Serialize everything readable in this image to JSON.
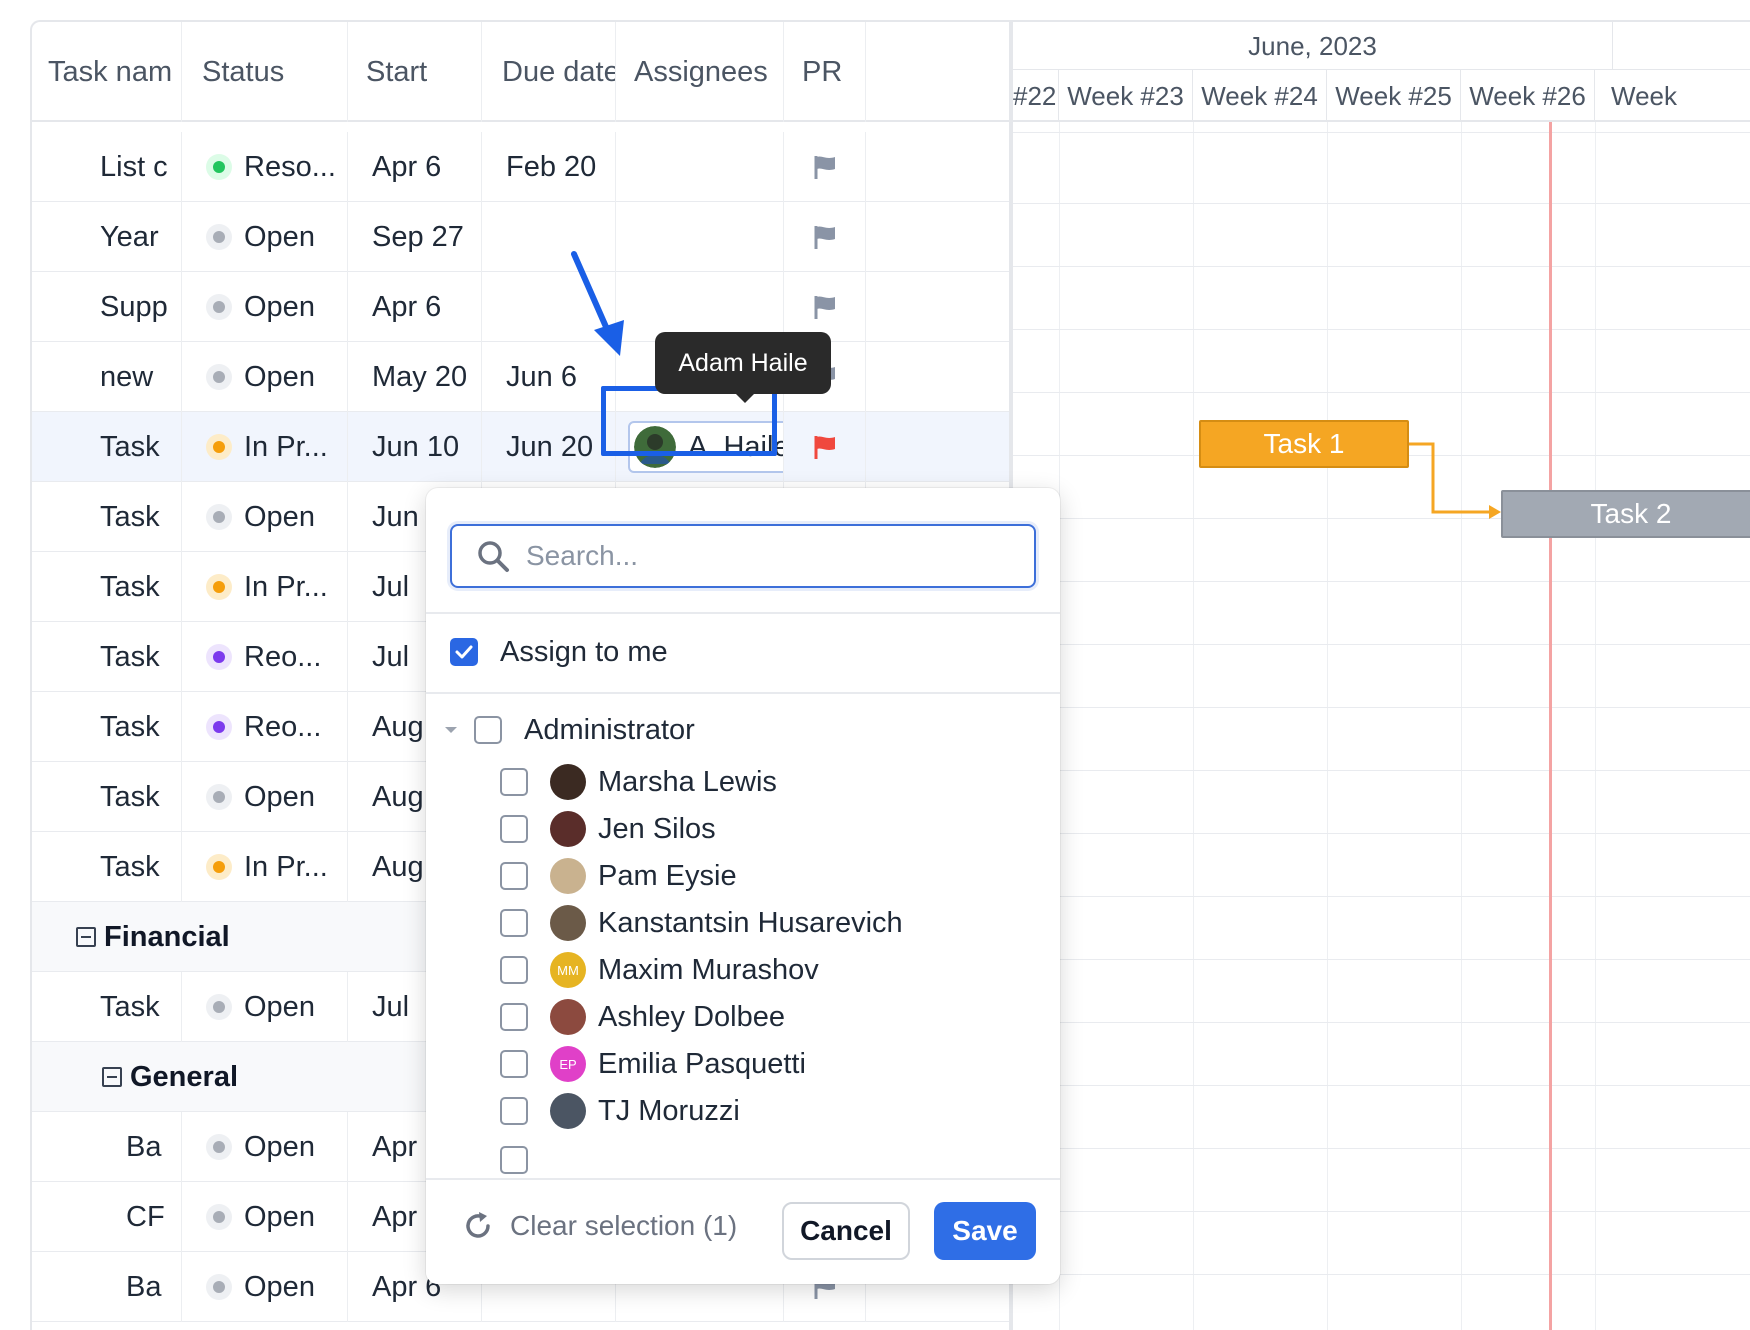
{
  "grid": {
    "headers": [
      "Task nam",
      "Status",
      "Start",
      "Due date",
      "Assignees",
      "PR"
    ],
    "rows": [
      {
        "name": "List c",
        "status": "Reso...",
        "status_color": "#22c55e",
        "start": "Apr 6",
        "due": "Feb 20",
        "flag": "gray"
      },
      {
        "name": "Year",
        "status": "Open",
        "status_color": "#a8adb6",
        "start": "Sep 27",
        "due": "",
        "flag": "gray"
      },
      {
        "name": "Supp",
        "status": "Open",
        "status_color": "#a8adb6",
        "start": "Apr 6",
        "due": "",
        "flag": "gray"
      },
      {
        "name": "new",
        "status": "Open",
        "status_color": "#a8adb6",
        "start": "May 20",
        "due": "Jun 6",
        "flag": "gray"
      },
      {
        "name": "Task",
        "status": "In Pr...",
        "status_color": "#f59e0b",
        "start": "Jun 10",
        "due": "Jun 20",
        "assignee": "A. Haile",
        "flag": "red"
      },
      {
        "name": "Task",
        "status": "Open",
        "status_color": "#a8adb6",
        "start": "Jun",
        "due": ""
      },
      {
        "name": "Task",
        "status": "In Pr...",
        "status_color": "#f59e0b",
        "start": "Jul",
        "due": ""
      },
      {
        "name": "Task",
        "status": "Reo...",
        "status_color": "#7c3aed",
        "start": "Jul",
        "due": ""
      },
      {
        "name": "Task",
        "status": "Reo...",
        "status_color": "#7c3aed",
        "start": "Aug",
        "due": ""
      },
      {
        "name": "Task",
        "status": "Open",
        "status_color": "#a8adb6",
        "start": "Aug",
        "due": ""
      },
      {
        "name": "Task",
        "status": "In Pr...",
        "status_color": "#f59e0b",
        "start": "Aug",
        "due": ""
      }
    ],
    "group_financial": "Financial",
    "financial_row": {
      "name": "Task",
      "status": "Open",
      "start": "Jul"
    },
    "group_general": "General",
    "general_rows": [
      {
        "name": "Ba",
        "status": "Open",
        "start": "Apr"
      },
      {
        "name": "CF",
        "status": "Open",
        "start": "Apr"
      },
      {
        "name": "Ba",
        "status": "Open",
        "start": "Apr 6"
      }
    ]
  },
  "gantt": {
    "month": "June, 2023",
    "weeks": [
      "#22",
      "Week #23",
      "Week #24",
      "Week #25",
      "Week #26",
      "Week"
    ],
    "bars": {
      "task1": "Task 1",
      "task2": "Task 2"
    },
    "colors": {
      "task1": "#f5a623",
      "task2": "#a2a9b3",
      "today": "#f4a3a3"
    }
  },
  "tooltip": {
    "text": "Adam Haile"
  },
  "dropdown": {
    "search_placeholder": "Search...",
    "assign_to_me": "Assign to me",
    "assign_to_me_checked": true,
    "group_label": "Administrator",
    "people": [
      {
        "name": "Marsha Lewis",
        "initials": "",
        "color": "#3b2a22"
      },
      {
        "name": "Jen Silos",
        "initials": "",
        "color": "#5a2d2a"
      },
      {
        "name": "Pam Eysie",
        "initials": "",
        "color": "#c9b28f"
      },
      {
        "name": "Kanstantsin Husarevich",
        "initials": "",
        "color": "#6b5a48"
      },
      {
        "name": "Maxim Murashov",
        "initials": "MM",
        "color": "#e6b422"
      },
      {
        "name": "Ashley Dolbee",
        "initials": "",
        "color": "#8c4a3f"
      },
      {
        "name": "Emilia Pasquetti",
        "initials": "EP",
        "color": "#e040c8"
      },
      {
        "name": "TJ Moruzzi",
        "initials": "",
        "color": "#4b5563"
      }
    ],
    "clear_selection": "Clear selection (1)",
    "cancel": "Cancel",
    "save": "Save"
  }
}
